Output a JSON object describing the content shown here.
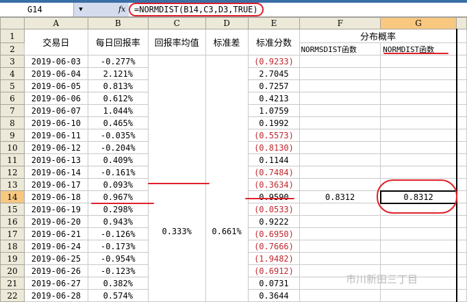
{
  "formula_bar": {
    "cell_ref": "G14",
    "fx": "fx",
    "formula": "=NORMDIST(B14,C3,D3,TRUE)",
    "dropdown": "▼"
  },
  "columns": [
    "A",
    "B",
    "C",
    "D",
    "E",
    "F",
    "G"
  ],
  "headers": {
    "date": "交易日",
    "daily_return": "每日回报率",
    "mean": "回报率均值",
    "std": "标准差",
    "zscore": "标准分数",
    "prob_group": "分布概率",
    "normsdist": "NORMSDIST函数",
    "normdist": "NORMDIST函数"
  },
  "rows": [
    {
      "n": "3",
      "date": "2019-06-03",
      "ret": "-0.277%",
      "z": "(0.9233)",
      "neg": true
    },
    {
      "n": "4",
      "date": "2019-06-04",
      "ret": "2.121%",
      "z": "2.7045",
      "neg": false
    },
    {
      "n": "5",
      "date": "2019-06-05",
      "ret": "0.813%",
      "z": "0.7257",
      "neg": false
    },
    {
      "n": "6",
      "date": "2019-06-06",
      "ret": "0.612%",
      "z": "0.4213",
      "neg": false
    },
    {
      "n": "7",
      "date": "2019-06-07",
      "ret": "1.044%",
      "z": "1.0759",
      "neg": false
    },
    {
      "n": "8",
      "date": "2019-06-10",
      "ret": "0.465%",
      "z": "0.1992",
      "neg": false
    },
    {
      "n": "9",
      "date": "2019-06-11",
      "ret": "-0.035%",
      "z": "(0.5573)",
      "neg": true
    },
    {
      "n": "10",
      "date": "2019-06-12",
      "ret": "-0.204%",
      "z": "(0.8130)",
      "neg": true
    },
    {
      "n": "11",
      "date": "2019-06-13",
      "ret": "0.409%",
      "z": "0.1144",
      "neg": false
    },
    {
      "n": "12",
      "date": "2019-06-14",
      "ret": "-0.161%",
      "z": "(0.7484)",
      "neg": true
    },
    {
      "n": "13",
      "date": "2019-06-17",
      "ret": "0.093%",
      "z": "(0.3634)",
      "neg": true
    },
    {
      "n": "14",
      "date": "2019-06-18",
      "ret": "0.967%",
      "z": "0.9590",
      "neg": false
    },
    {
      "n": "15",
      "date": "2019-06-19",
      "ret": "0.298%",
      "z": "(0.0533)",
      "neg": true
    },
    {
      "n": "16",
      "date": "2019-06-20",
      "ret": "0.943%",
      "z": "0.9222",
      "neg": false
    },
    {
      "n": "17",
      "date": "2019-06-21",
      "ret": "-0.126%",
      "z": "(0.6950)",
      "neg": true
    },
    {
      "n": "18",
      "date": "2019-06-24",
      "ret": "-0.173%",
      "z": "(0.7666)",
      "neg": true
    },
    {
      "n": "19",
      "date": "2019-06-25",
      "ret": "-0.954%",
      "z": "(1.9482)",
      "neg": true
    },
    {
      "n": "20",
      "date": "2019-06-26",
      "ret": "-0.123%",
      "z": "(0.6912)",
      "neg": true
    },
    {
      "n": "21",
      "date": "2019-06-27",
      "ret": "0.382%",
      "z": "0.0731",
      "neg": false
    },
    {
      "n": "22",
      "date": "2019-06-28",
      "ret": "0.574%",
      "z": "0.3644",
      "neg": false
    }
  ],
  "mean_value": "0.333%",
  "std_value": "0.661%",
  "f14": "0.8312",
  "g14": "0.8312",
  "watermark": "市川新田三丁目"
}
